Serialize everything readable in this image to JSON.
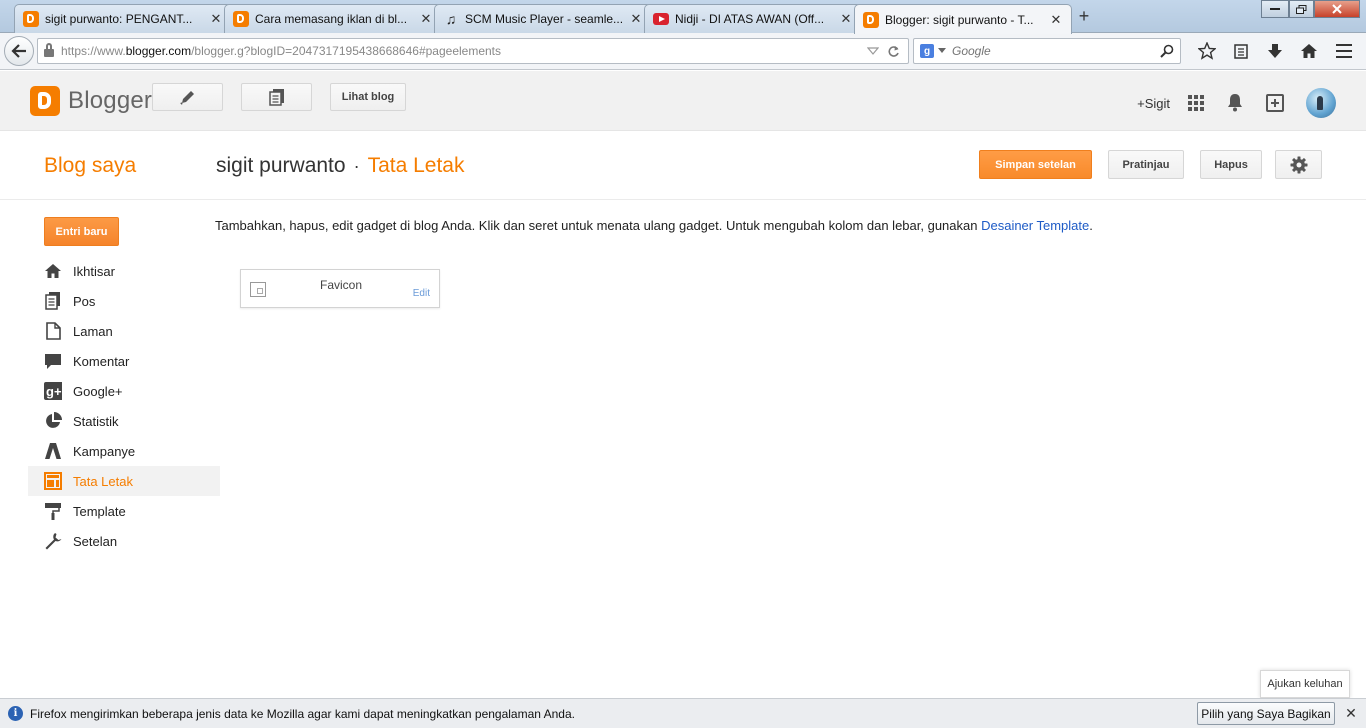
{
  "browser": {
    "tabs": [
      {
        "title": "sigit purwanto: PENGANT...",
        "icon": "blogger-icon"
      },
      {
        "title": "Cara memasang iklan di bl...",
        "icon": "blogger-icon"
      },
      {
        "title": "SCM Music Player - seamle...",
        "icon": "music-note-icon"
      },
      {
        "title": "Nidji - DI ATAS AWAN (Off...",
        "icon": "youtube-icon"
      },
      {
        "title": "Blogger: sigit purwanto - T...",
        "icon": "blogger-icon",
        "active": true
      }
    ],
    "new_tab": "+",
    "close_glyph": "✕",
    "url_prefix": "https://www.",
    "url_domain": "blogger.com",
    "url_rest": "/blogger.g?blogID=2047317195438668646#pageelements",
    "search_placeholder": "Google",
    "search_engine_letter": "g"
  },
  "header": {
    "logo_text": "Blogger",
    "view_blog": "Lihat blog",
    "user": "+Sigit"
  },
  "titlebar": {
    "blog_saya": "Blog saya",
    "blog_name": "sigit purwanto",
    "separator": "·",
    "page": "Tata Letak",
    "save": "Simpan setelan",
    "preview": "Pratinjau",
    "delete": "Hapus"
  },
  "sidebar": {
    "new_post": "Entri baru",
    "items": [
      {
        "label": "Ikhtisar",
        "icon": "home-icon"
      },
      {
        "label": "Pos",
        "icon": "posts-icon"
      },
      {
        "label": "Laman",
        "icon": "page-icon"
      },
      {
        "label": "Komentar",
        "icon": "comment-icon"
      },
      {
        "label": "Google+",
        "icon": "google-plus-icon"
      },
      {
        "label": "Statistik",
        "icon": "pie-chart-icon"
      },
      {
        "label": "Kampanye",
        "icon": "campaign-icon"
      },
      {
        "label": "Tata Letak",
        "icon": "layout-icon",
        "active": true
      },
      {
        "label": "Template",
        "icon": "paint-roller-icon"
      },
      {
        "label": "Setelan",
        "icon": "wrench-icon"
      }
    ]
  },
  "content": {
    "intro": "Tambahkan, hapus, edit gadget di blog Anda. Klik dan seret untuk menata ulang gadget. Untuk mengubah kolom dan lebar, gunakan ",
    "intro_link": "Desainer Template",
    "intro_end": ".",
    "gadget": {
      "title": "Favicon",
      "edit": "Edit"
    }
  },
  "feedback": "Ajukan keluhan",
  "notification": {
    "text": "Firefox mengirimkan beberapa jenis data ke Mozilla agar kami dapat meningkatkan pengalaman Anda.",
    "button": "Pilih yang Saya Bagikan",
    "close": "✕"
  },
  "colors": {
    "accent": "#f57d00",
    "link": "#1e5bc6",
    "primary_button": "#f88a2b"
  }
}
